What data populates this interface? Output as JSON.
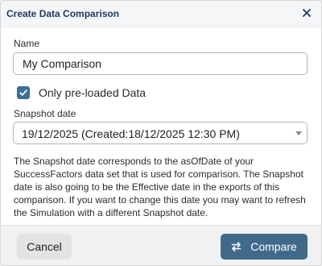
{
  "dialog": {
    "title": "Create Data Comparison",
    "close_icon": "close-icon"
  },
  "form": {
    "name_label": "Name",
    "name_value": "My Comparison",
    "preloaded_label": "Only pre-loaded Data",
    "preloaded_checked": true,
    "snapshot_label": "Snapshot date",
    "snapshot_value": "19/12/2025 (Created:18/12/2025 12:30 PM)",
    "description": "The Snapshot date corresponds to the asOfDate of your SuccessFactors data set that is used for comparison. The Snapshot date is also going to be the Effective date in the exports of this comparison. If you want to change this date you may want to refresh the Simulation with a different Snapshot date."
  },
  "footer": {
    "cancel_label": "Cancel",
    "compare_label": "Compare",
    "compare_icon": "swap-icon"
  },
  "colors": {
    "accent": "#416a8a",
    "checkbox": "#3d6f95",
    "title": "#1c3a5c"
  }
}
